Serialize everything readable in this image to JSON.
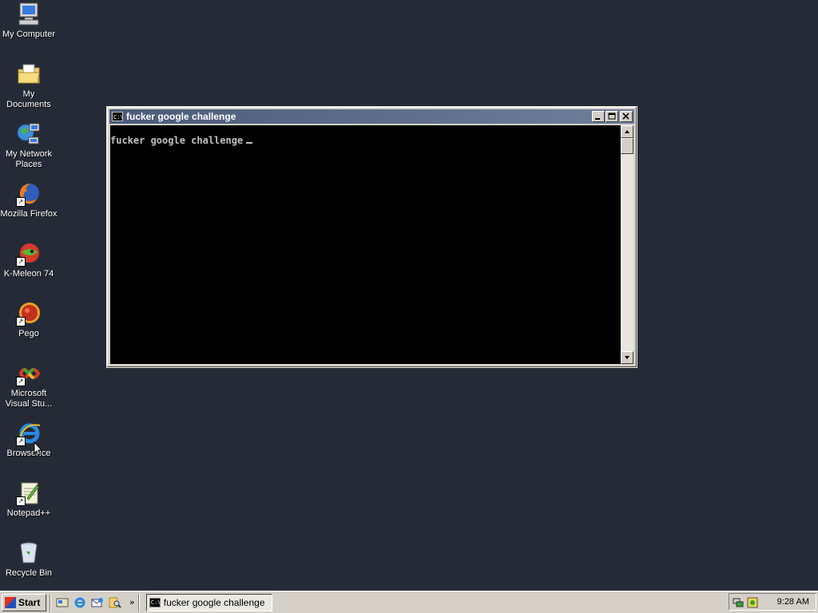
{
  "desktop": {
    "icons": [
      {
        "label": "My Computer",
        "icon": "computer-icon"
      },
      {
        "label": "My Documents",
        "icon": "folder-documents-icon"
      },
      {
        "label": "My Network Places",
        "icon": "network-icon"
      },
      {
        "label": "Mozilla Firefox",
        "icon": "firefox-icon"
      },
      {
        "label": "K-Meleon 74",
        "icon": "k-meleon-icon"
      },
      {
        "label": "Pego",
        "icon": "pego-icon"
      },
      {
        "label": "Microsoft Visual Stu...",
        "icon": "visual-studio-icon"
      },
      {
        "label": "BrowserIce",
        "icon": "internet-explorer-icon"
      },
      {
        "label": "Notepad++",
        "icon": "notepad-plus-plus-icon"
      },
      {
        "label": "Recycle Bin",
        "icon": "recycle-bin-icon"
      }
    ]
  },
  "console": {
    "title": "fucker google challenge",
    "title_icon": "C:\\",
    "text": "fucker google challenge"
  },
  "taskbar": {
    "start_label": "Start",
    "task_label": "fucker google challenge",
    "task_icon": "C:\\",
    "chevron": "»",
    "clock": "9:28 AM"
  },
  "colors": {
    "desktop": "#252b36",
    "titlebar_start": "#4a5a78",
    "titlebar_end": "#6f7f9b",
    "console_bg": "#000000",
    "console_fg": "#c0c0c0"
  }
}
